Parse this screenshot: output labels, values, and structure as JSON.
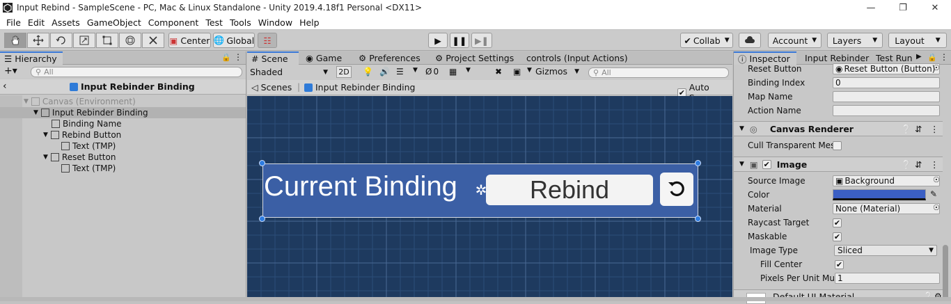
{
  "window": {
    "title": "Input Rebind - SampleScene - PC, Mac & Linux Standalone - Unity 2019.4.18f1 Personal <DX11>"
  },
  "menu": [
    "File",
    "Edit",
    "Assets",
    "GameObject",
    "Component",
    "Test",
    "Tools",
    "Window",
    "Help"
  ],
  "toolbar": {
    "pivot_label": "Center",
    "space_label": "Global",
    "collab_label": "Collab",
    "account_label": "Account",
    "layers_label": "Layers",
    "layout_label": "Layout"
  },
  "hierarchy": {
    "tab": "Hierarchy",
    "search_placeholder": "All",
    "breadcrumb": "Input Rebinder Binding",
    "items": [
      {
        "label": "Canvas (Environment)"
      },
      {
        "label": "Input Rebinder Binding"
      },
      {
        "label": "Binding Name"
      },
      {
        "label": "Rebind Button"
      },
      {
        "label": "Text (TMP)"
      },
      {
        "label": "Reset Button"
      },
      {
        "label": "Text (TMP)"
      }
    ]
  },
  "scene": {
    "tabs": [
      "Scene",
      "Game",
      "Preferences",
      "Project Settings",
      "controls (Input Actions)"
    ],
    "shading": "Shaded",
    "mode_2d": "2D",
    "fx_count": "0",
    "gizmos": "Gizmos",
    "search_placeholder": "All",
    "breadcrumb_scenes": "Scenes",
    "breadcrumb_object": "Input Rebinder Binding",
    "autosave": "Auto Save",
    "binding_text": "Current Binding",
    "rebind_text": "Rebind",
    "bg_color": "#1e3a5f",
    "panel_color": "#3b5fa5"
  },
  "inspector": {
    "tabs": [
      "Inspector",
      "Input Rebinder",
      "Test Run"
    ],
    "rows1": [
      {
        "label": "Reset Button",
        "value": "Reset Button (Button)"
      },
      {
        "label": "Binding Index",
        "value": "0"
      },
      {
        "label": "Map Name",
        "value": ""
      },
      {
        "label": "Action Name",
        "value": ""
      }
    ],
    "canvas_renderer": {
      "title": "Canvas Renderer",
      "cull_label": "Cull Transparent Mes"
    },
    "image": {
      "title": "Image",
      "source_image_label": "Source Image",
      "source_image_value": "Background",
      "color_label": "Color",
      "color_value": "#3b5fc4",
      "material_label": "Material",
      "material_value": "None (Material)",
      "raycast_label": "Raycast Target",
      "maskable_label": "Maskable",
      "image_type_label": "Image Type",
      "image_type_value": "Sliced",
      "fill_center_label": "Fill Center",
      "ppu_label": "Pixels Per Unit Mul",
      "ppu_value": "1"
    },
    "material_footer": "Default UI Material"
  }
}
